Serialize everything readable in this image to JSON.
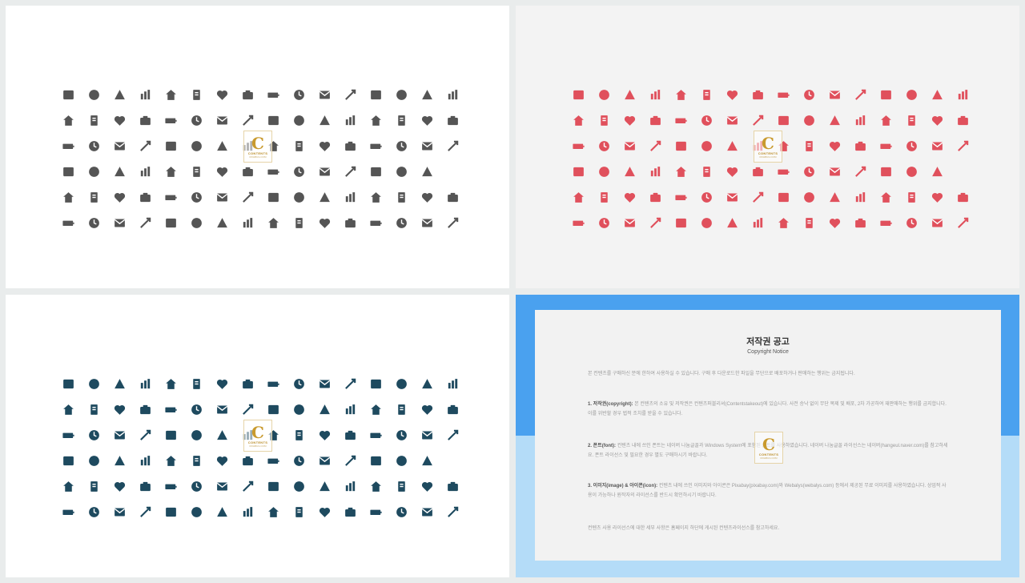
{
  "slides": [
    {
      "id": "s1",
      "name": "slide-icons-gray",
      "color": "#555555",
      "background": "#ffffff"
    },
    {
      "id": "s2",
      "name": "slide-icons-red",
      "color": "#e0505c",
      "background": "#f3f3f3"
    },
    {
      "id": "s3",
      "name": "slide-icons-navy",
      "color": "#1e4a5f",
      "background": "#ffffff"
    }
  ],
  "icons": [
    "bank",
    "capitol",
    "house",
    "factory",
    "target",
    "bullseye",
    "puzzle",
    "clipboard",
    "paperclip",
    "newspaper",
    "trophy",
    "document",
    "key",
    "pushpin",
    "books",
    "lightning",
    "lock",
    "briefcase",
    "presentation",
    "chart-up",
    "chart-down",
    "bar-chart",
    "bar-chart-2",
    "bar-chart-3",
    "pie-chart",
    "clock",
    "stopwatch",
    "alarm-clock",
    "hourglass",
    "calendar-box",
    "calendar-28",
    "calendar-clock",
    "refresh",
    "book-open",
    "user-man",
    "user-woman",
    "user-desk",
    "chart-board",
    "org-chart",
    "team-meeting",
    "document-stack",
    "id-card",
    "clipboard-check",
    "calendar-grid",
    "person-tie",
    "group",
    "people-chart",
    "hierarchy",
    "time-settings",
    "question",
    "exclamation",
    "warning",
    "info",
    "coins",
    "credit-card",
    "wallet",
    "cash-register",
    "shop",
    "mobile-wallet",
    "document-lines",
    "safe",
    "piggy-bank",
    "money-bag",
    "none",
    "pound-coin",
    "shopping-cart",
    "cart-add",
    "cart-remove",
    "basket",
    "calculator",
    "percent",
    "clock-money",
    "credit-card-2",
    "open-box",
    "gift",
    "tag",
    "purse",
    "gavel",
    "shopping-bag",
    "gear",
    "heart",
    "twitter",
    "microphone",
    "globe",
    "fax",
    "phone-book",
    "telephone-handset",
    "chat",
    "chat-bubbles",
    "envelope",
    "envelope-open",
    "fax-machine",
    "stamp",
    "phone-vibrate",
    "battery-low",
    "battery-empty"
  ],
  "watermark": {
    "letter": "C",
    "line1": "CONTENTS",
    "line2": "ROHBUG.COM"
  },
  "notice": {
    "title": "저작권 공고",
    "subtitle": "Copyright Notice",
    "intro": "본 컨텐츠를 구매하신 분에 한하여 사용하실 수 있습니다. 구매 후 다운로드한 파일을 무단으로 배포하거나 판매하는 행위는 금지됩니다.",
    "s1_label": "1. 저작권(copyright):",
    "s1_text": "본 컨텐츠의 소유 및 저작권은 컨텐츠퍼블리셔(Contentstakeout)에 있습니다. 사전 승낙 없이 무단 복제 및 배포, 2차 가공하여 재판매하는 행위를 금지합니다. 이를 위반할 경우 법적 조치를 받을 수 있습니다.",
    "s2_label": "2. 폰트(font):",
    "s2_text": "컨텐츠 내에 쓰인 폰트는 네이버 나눔글꼴과 Windows System에 포함된 폰트를 사용하였습니다. 네이버 나눔글꼴 라이선스는 네이버(hangeul.naver.com)를 참고하세요. 폰트 라이선스 및 필요한 경우 별도 구매하시기 바랍니다.",
    "s3_label": "3. 이미지(image) & 아이콘(icon):",
    "s3_text": "컨텐츠 내에 쓰인 이미지와 아이콘은 Pixabay(pixabay.com)와 Webalys(webalys.com) 등에서 제공된 무료 이미지를 사용하였습니다. 상업적 사용이 가능하나 원작자의 라이선스를 반드시 확인하시기 바랍니다.",
    "footer": "컨텐츠 사용 라이선스에 대한 세부 사항은 홈페이지 하단에 게시된 컨텐츠라이선스를 참고하세요."
  }
}
